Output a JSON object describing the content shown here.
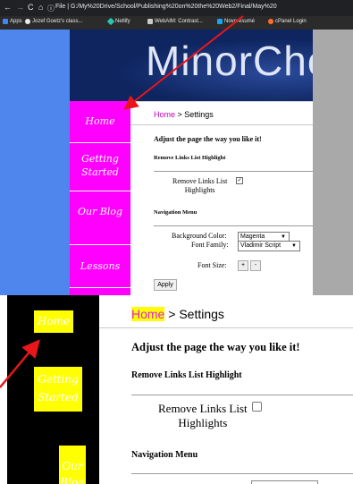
{
  "browser": {
    "nav_back": "←",
    "nav_forward": "→",
    "nav_reload": "C",
    "nav_home": "⌂",
    "info_icon": "ⓘ",
    "url_prefix": "File",
    "url": "G:/My%20Drive/School/Publishing%20on%20the%20Web2/Final/May%20",
    "bookmarks": [
      {
        "label": "Apps",
        "icon_color": "#4285f4"
      },
      {
        "label": "Jozef Goetz's class...",
        "icon_color": "#e8eaed"
      },
      {
        "label": "Netlify",
        "icon_color": "#25c7b7"
      },
      {
        "label": "WebAIM: Contrast...",
        "icon_color": "#c9c9c9"
      },
      {
        "label": "Novorésumé",
        "icon_color": "#1da1f2"
      },
      {
        "label": "cPanel Login",
        "icon_color": "#ff6c2c"
      }
    ]
  },
  "site": {
    "title": "MinorCho",
    "nav": [
      "Home",
      "Getting Started",
      "Our Blog",
      "Lessons"
    ],
    "nav_color": "#ff00ff"
  },
  "settings": {
    "breadcrumb_home": "Home",
    "breadcrumb_sep": " > ",
    "breadcrumb_page": "Settings",
    "heading": "Adjust the page the way you like it!",
    "section_links": "Remove Links List Highlight",
    "remove_links_label": "Remove Links List Highlights",
    "remove_links_label_line1": "Remove Links List",
    "remove_links_label_line2": "Highlights",
    "section_nav": "Navigation Menu",
    "background_color_label": "Background Color:",
    "background_color_value": "Magenta",
    "font_family_label": "Font Family:",
    "font_family_value": "Vladimir Script",
    "font_size_label": "Font Size:",
    "font_plus": "+",
    "font_minus": "-",
    "apply_button": "Apply"
  },
  "zoomed": {
    "nav": [
      "Home",
      "Getting Started",
      "Our Blog"
    ],
    "nav_bg": "#000000",
    "highlight_color": "#ffff00",
    "arrow_color": "#e8161b"
  }
}
